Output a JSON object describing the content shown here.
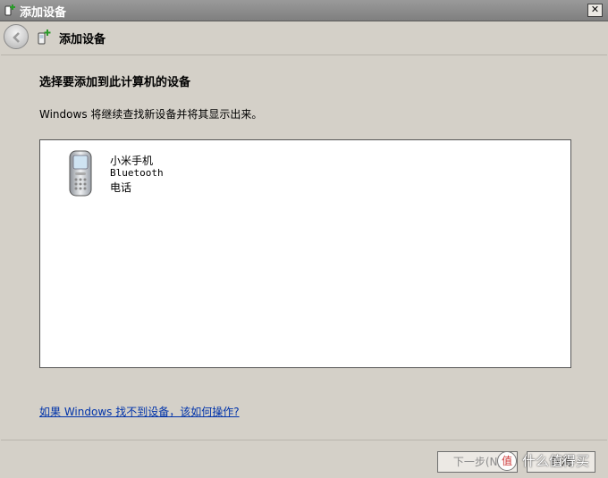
{
  "window": {
    "title": "添加设备",
    "close_glyph": "✕"
  },
  "nav": {
    "title": "添加设备"
  },
  "main": {
    "heading": "选择要添加到此计算机的设备",
    "subtext": "Windows 将继续查找新设备并将其显示出来。",
    "devices": [
      {
        "name": "小米手机",
        "type": "Bluetooth",
        "category": "电话",
        "icon": "mobile-phone-icon"
      }
    ],
    "help_link": "如果 Windows 找不到设备，该如何操作?"
  },
  "footer": {
    "next_label": "下一步(N)",
    "cancel_label": "取消"
  },
  "watermark": {
    "glyph": "值",
    "text": "什么值得买"
  },
  "colors": {
    "link": "#0033aa",
    "titlebar": "#8a8a8a",
    "disabled_text": "#8c8c8c"
  }
}
